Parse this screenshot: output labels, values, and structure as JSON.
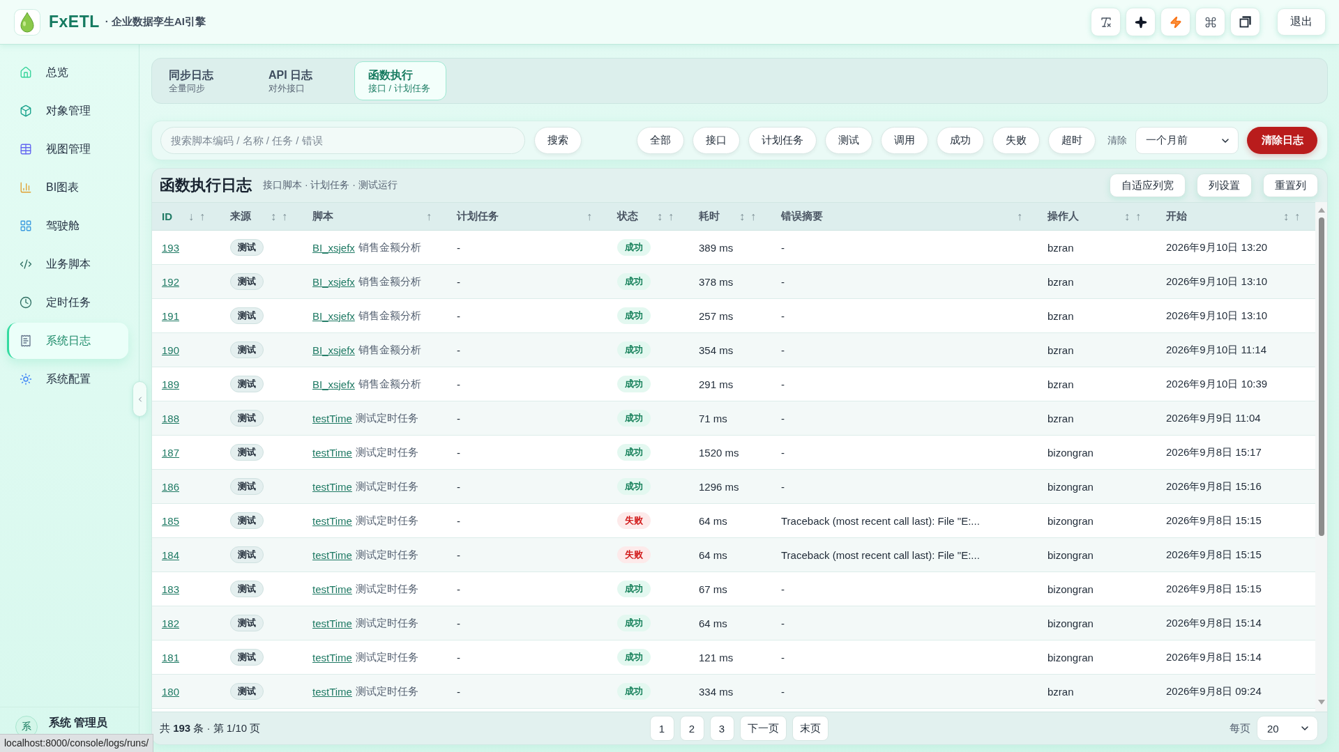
{
  "header": {
    "brand": "FxETL",
    "tagline": "· 企业数据孪生AI引擎",
    "logout": "退出"
  },
  "sidebar": {
    "items": [
      {
        "label": "总览",
        "kind": "home",
        "selected": false
      },
      {
        "label": "对象管理",
        "kind": "cube",
        "selected": false
      },
      {
        "label": "视图管理",
        "kind": "table",
        "selected": false
      },
      {
        "label": "BI图表",
        "kind": "chart",
        "selected": false
      },
      {
        "label": "驾驶舱",
        "kind": "grid",
        "selected": false
      },
      {
        "label": "业务脚本",
        "kind": "code",
        "selected": false
      },
      {
        "label": "定时任务",
        "kind": "clock",
        "selected": false
      },
      {
        "label": "系统日志",
        "kind": "document",
        "selected": true
      },
      {
        "label": "系统配置",
        "kind": "sun",
        "selected": false
      }
    ],
    "user": {
      "avatar": "系",
      "name": "系统 管理员"
    }
  },
  "tabs": [
    {
      "title": "同步日志",
      "subtitle": "全量同步",
      "selected": false
    },
    {
      "title": "API 日志",
      "subtitle": "对外接口",
      "selected": false
    },
    {
      "title": "函数执行",
      "subtitle": "接口 / 计划任务",
      "selected": true
    }
  ],
  "filter_bar": {
    "search": {
      "placeholder": "搜索脚本编码 / 名称 / 任务 / 错误"
    },
    "search_button": "搜索",
    "chips": [
      {
        "label": "全部",
        "selected": false
      },
      {
        "label": "接口",
        "selected": false
      },
      {
        "label": "计划任务",
        "selected": false
      },
      {
        "label": "测试",
        "selected": false
      },
      {
        "label": "调用",
        "selected": false
      },
      {
        "label": "成功",
        "selected": false
      },
      {
        "label": "失败",
        "selected": false
      },
      {
        "label": "超时",
        "selected": false
      }
    ],
    "clear_label": "清除",
    "clear_range": "一个月前",
    "clear_button": "清除日志"
  },
  "log_table": {
    "title": "函数执行日志",
    "subtitle": "接口脚本 · 计划任务 · 测试运行",
    "actions": [
      "自适应列宽",
      "列设置",
      "重置列"
    ],
    "columns": [
      {
        "label": "ID",
        "sorted": true,
        "sort_marks": [
          "↓",
          "↑"
        ]
      },
      {
        "label": "来源",
        "sorted": false,
        "sort_marks": [
          "↕",
          "↑"
        ]
      },
      {
        "label": "脚本",
        "sorted": false,
        "sort_marks": [
          "↑"
        ]
      },
      {
        "label": "计划任务",
        "sorted": false,
        "sort_marks": [
          "↑"
        ]
      },
      {
        "label": "状态",
        "sorted": false,
        "sort_marks": [
          "↕",
          "↑"
        ]
      },
      {
        "label": "耗时",
        "sorted": false,
        "sort_marks": [
          "↕",
          "↑"
        ]
      },
      {
        "label": "错误摘要",
        "sorted": false,
        "sort_marks": [
          "↑"
        ]
      },
      {
        "label": "操作人",
        "sorted": false,
        "sort_marks": [
          "↕",
          "↑"
        ]
      },
      {
        "label": "开始",
        "sorted": false,
        "sort_marks": [
          "↕",
          "↑"
        ]
      }
    ],
    "rows": [
      {
        "id": "193",
        "source": "测试",
        "script": {
          "code": "BI_xsjefx",
          "name": "销售金额分析"
        },
        "task": "-",
        "status": {
          "label": "成功",
          "kind": "success"
        },
        "duration": "389 ms",
        "error": "-",
        "operator": "bzran",
        "started": "2026年9月10日 13:20"
      },
      {
        "id": "192",
        "source": "测试",
        "script": {
          "code": "BI_xsjefx",
          "name": "销售金额分析"
        },
        "task": "-",
        "status": {
          "label": "成功",
          "kind": "success"
        },
        "duration": "378 ms",
        "error": "-",
        "operator": "bzran",
        "started": "2026年9月10日 13:10"
      },
      {
        "id": "191",
        "source": "测试",
        "script": {
          "code": "BI_xsjefx",
          "name": "销售金额分析"
        },
        "task": "-",
        "status": {
          "label": "成功",
          "kind": "success"
        },
        "duration": "257 ms",
        "error": "-",
        "operator": "bzran",
        "started": "2026年9月10日 13:10"
      },
      {
        "id": "190",
        "source": "测试",
        "script": {
          "code": "BI_xsjefx",
          "name": "销售金额分析"
        },
        "task": "-",
        "status": {
          "label": "成功",
          "kind": "success"
        },
        "duration": "354 ms",
        "error": "-",
        "operator": "bzran",
        "started": "2026年9月10日 11:14"
      },
      {
        "id": "189",
        "source": "测试",
        "script": {
          "code": "BI_xsjefx",
          "name": "销售金额分析"
        },
        "task": "-",
        "status": {
          "label": "成功",
          "kind": "success"
        },
        "duration": "291 ms",
        "error": "-",
        "operator": "bzran",
        "started": "2026年9月10日 10:39"
      },
      {
        "id": "188",
        "source": "测试",
        "script": {
          "code": "testTime",
          "name": "测试定时任务"
        },
        "task": "-",
        "status": {
          "label": "成功",
          "kind": "success"
        },
        "duration": "71 ms",
        "error": "-",
        "operator": "bzran",
        "started": "2026年9月9日 11:04"
      },
      {
        "id": "187",
        "source": "测试",
        "script": {
          "code": "testTime",
          "name": "测试定时任务"
        },
        "task": "-",
        "status": {
          "label": "成功",
          "kind": "success"
        },
        "duration": "1520 ms",
        "error": "-",
        "operator": "bizongran",
        "started": "2026年9月8日 15:17"
      },
      {
        "id": "186",
        "source": "测试",
        "script": {
          "code": "testTime",
          "name": "测试定时任务"
        },
        "task": "-",
        "status": {
          "label": "成功",
          "kind": "success"
        },
        "duration": "1296 ms",
        "error": "-",
        "operator": "bizongran",
        "started": "2026年9月8日 15:16"
      },
      {
        "id": "185",
        "source": "测试",
        "script": {
          "code": "testTime",
          "name": "测试定时任务"
        },
        "task": "-",
        "status": {
          "label": "失败",
          "kind": "failure"
        },
        "duration": "64 ms",
        "error": "Traceback (most recent call last): File \"E:...",
        "operator": "bizongran",
        "started": "2026年9月8日 15:15"
      },
      {
        "id": "184",
        "source": "测试",
        "script": {
          "code": "testTime",
          "name": "测试定时任务"
        },
        "task": "-",
        "status": {
          "label": "失败",
          "kind": "failure"
        },
        "duration": "64 ms",
        "error": "Traceback (most recent call last): File \"E:...",
        "operator": "bizongran",
        "started": "2026年9月8日 15:15"
      },
      {
        "id": "183",
        "source": "测试",
        "script": {
          "code": "testTime",
          "name": "测试定时任务"
        },
        "task": "-",
        "status": {
          "label": "成功",
          "kind": "success"
        },
        "duration": "67 ms",
        "error": "-",
        "operator": "bizongran",
        "started": "2026年9月8日 15:15"
      },
      {
        "id": "182",
        "source": "测试",
        "script": {
          "code": "testTime",
          "name": "测试定时任务"
        },
        "task": "-",
        "status": {
          "label": "成功",
          "kind": "success"
        },
        "duration": "64 ms",
        "error": "-",
        "operator": "bizongran",
        "started": "2026年9月8日 15:14"
      },
      {
        "id": "181",
        "source": "测试",
        "script": {
          "code": "testTime",
          "name": "测试定时任务"
        },
        "task": "-",
        "status": {
          "label": "成功",
          "kind": "success"
        },
        "duration": "121 ms",
        "error": "-",
        "operator": "bizongran",
        "started": "2026年9月8日 15:14"
      },
      {
        "id": "180",
        "source": "测试",
        "script": {
          "code": "testTime",
          "name": "测试定时任务"
        },
        "task": "-",
        "status": {
          "label": "成功",
          "kind": "success"
        },
        "duration": "334 ms",
        "error": "-",
        "operator": "bzran",
        "started": "2026年9月8日 09:24"
      }
    ]
  },
  "pagination": {
    "summary": "共 **193** 条 · 第 1/10 页",
    "pages": [
      {
        "label": "1",
        "selected": false
      },
      {
        "label": "2",
        "selected": false
      },
      {
        "label": "3",
        "selected": false
      }
    ],
    "next": "下一页",
    "last": "末页",
    "page_size_label": "每页",
    "page_size": "20"
  },
  "status_url": "localhost:8000/console/logs/runs/"
}
